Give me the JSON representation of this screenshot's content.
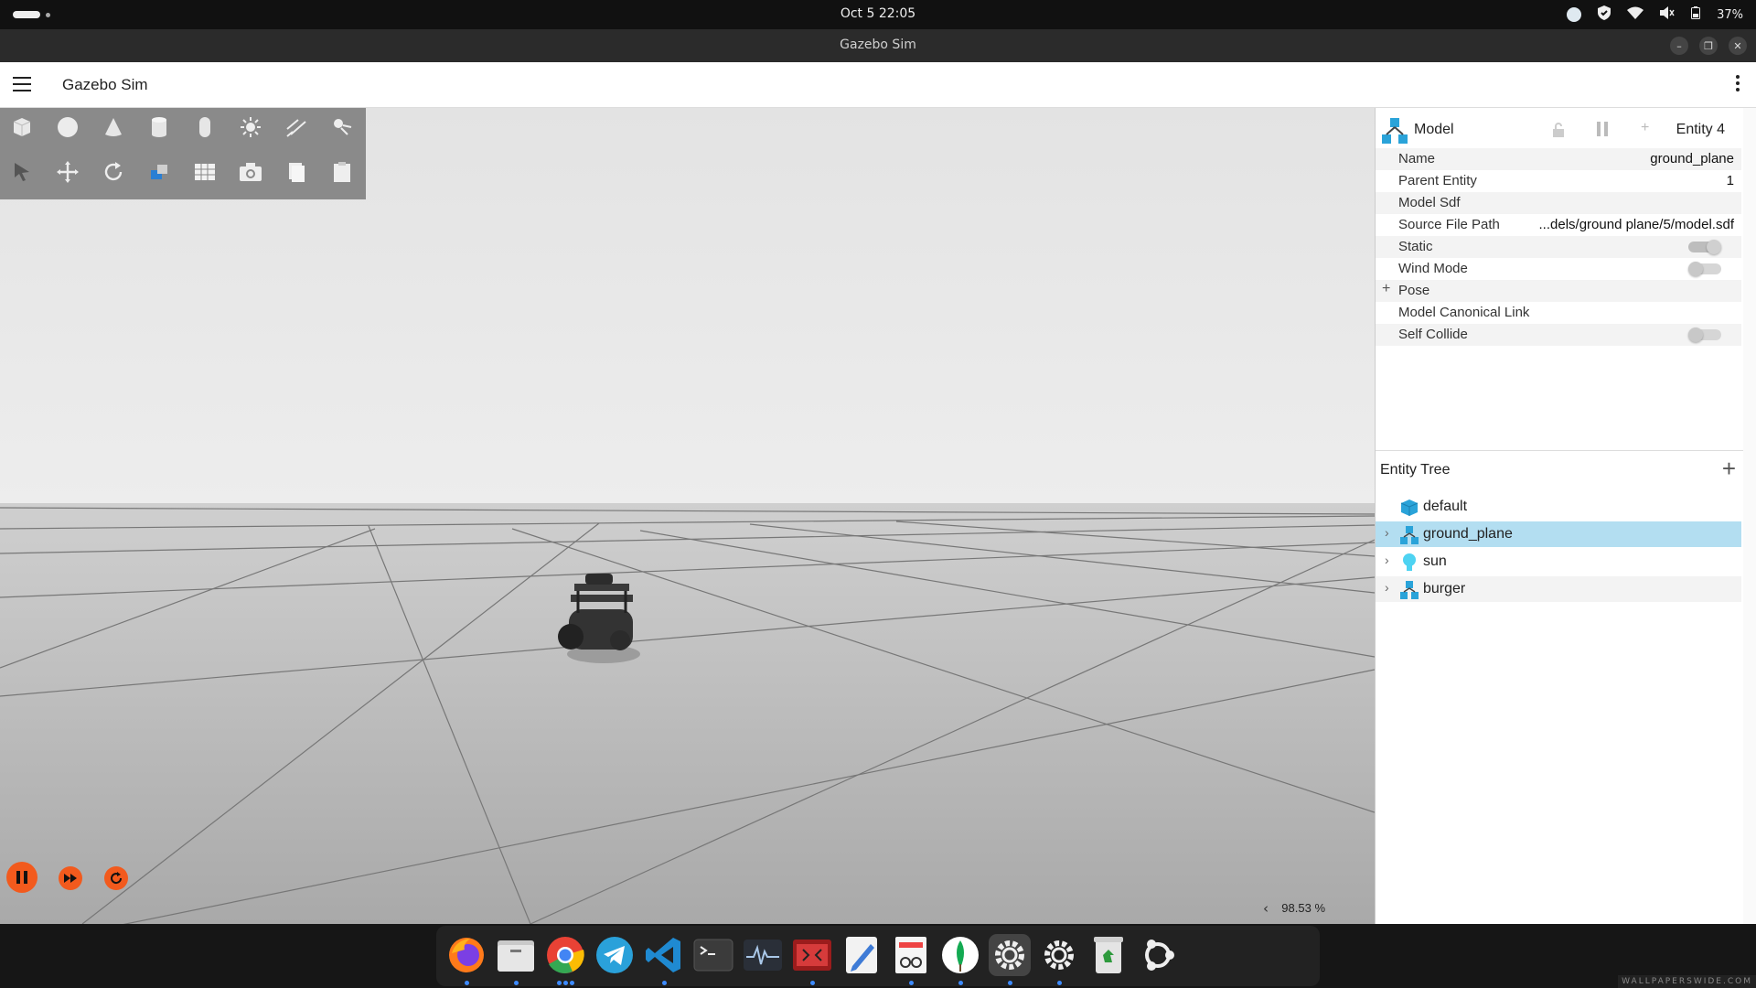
{
  "system": {
    "clock": "Oct 5  22:05",
    "battery": "37%"
  },
  "window": {
    "title": "Gazebo Sim"
  },
  "app": {
    "title": "Gazebo Sim"
  },
  "toolbar": {
    "row1": [
      "box-icon",
      "sphere-icon",
      "cone-icon",
      "cylinder-icon",
      "capsule-icon",
      "sun-light-icon",
      "directional-light-icon",
      "spot-light-icon"
    ],
    "row2": [
      "select-icon",
      "translate-icon",
      "rotate-icon",
      "transform-icon",
      "grid-icon",
      "camera-icon",
      "copy-icon",
      "paste-icon"
    ]
  },
  "playback": {
    "rtf": "98.53 %",
    "chevron": "‹"
  },
  "component_inspector": {
    "type_label": "Model",
    "entity_label": "Entity 4",
    "rows": [
      {
        "key": "Name",
        "value": "ground_plane"
      },
      {
        "key": "Parent Entity",
        "value": "1"
      },
      {
        "key": "Model Sdf",
        "value": ""
      },
      {
        "key": "Source File Path",
        "value": "...dels/ground plane/5/model.sdf"
      },
      {
        "key": "Static",
        "value": "",
        "toggle": true
      },
      {
        "key": "Wind Mode",
        "value": "",
        "toggle": false
      },
      {
        "key": "Pose",
        "value": ""
      },
      {
        "key": "Model Canonical Link",
        "value": ""
      },
      {
        "key": "Self Collide",
        "value": "",
        "toggle": false
      }
    ],
    "pose_expander": "+"
  },
  "entity_tree": {
    "title": "Entity Tree",
    "add": "+",
    "items": [
      {
        "label": "default",
        "icon": "world-icon"
      },
      {
        "label": "ground_plane",
        "icon": "model-icon"
      },
      {
        "label": "sun",
        "icon": "light-icon"
      },
      {
        "label": "burger",
        "icon": "model-icon"
      }
    ]
  },
  "dock": {
    "apps": [
      "firefox-icon",
      "files-icon",
      "chrome-icon",
      "telegram-icon",
      "vscode-icon",
      "terminal-icon",
      "system-monitor-icon",
      "app-icon",
      "text-editor-icon",
      "document-viewer-icon",
      "mongodb-compass-icon",
      "gazebo-settings-icon",
      "gazebo-settings-icon-2",
      "trash-icon",
      "ubuntu-icon"
    ]
  },
  "watermark": "WALLPAPERSWIDE.COM",
  "colors": {
    "accent": "#f25a1d",
    "selection": "#b3def1",
    "model_icon": "#2aa3d9"
  }
}
